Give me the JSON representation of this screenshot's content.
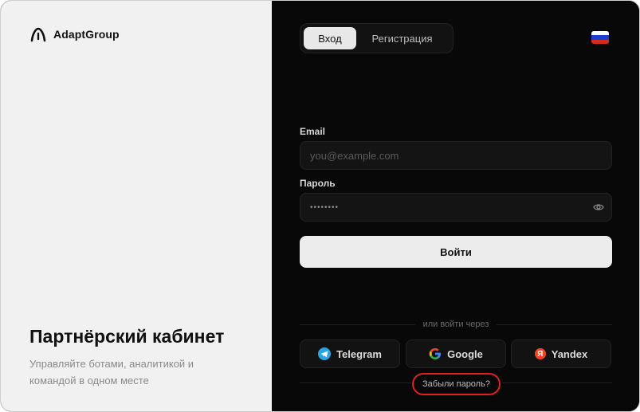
{
  "brand": {
    "name": "AdaptGroup"
  },
  "hero": {
    "title": "Партнёрский кабинет",
    "subtitle": "Управляйте ботами, аналитикой и командой в одном месте"
  },
  "tabs": [
    {
      "label": "Вход",
      "active": true
    },
    {
      "label": "Регистрация",
      "active": false
    }
  ],
  "language": {
    "icon": "russia-flag-icon"
  },
  "form": {
    "email_label": "Email",
    "email_placeholder": "you@example.com",
    "password_label": "Пароль",
    "password_value": "••••••••",
    "submit_label": "Войти"
  },
  "social": {
    "divider_text": "или войти через",
    "providers": [
      {
        "label": "Telegram",
        "icon": "telegram-icon"
      },
      {
        "label": "Google",
        "icon": "google-icon"
      },
      {
        "label": "Yandex",
        "icon": "yandex-icon"
      }
    ]
  },
  "forgot_password": "Забыли пароль?",
  "colors": {
    "accent": "#e02020",
    "panel_dark": "#080808",
    "panel_light": "#f1f1f1"
  }
}
